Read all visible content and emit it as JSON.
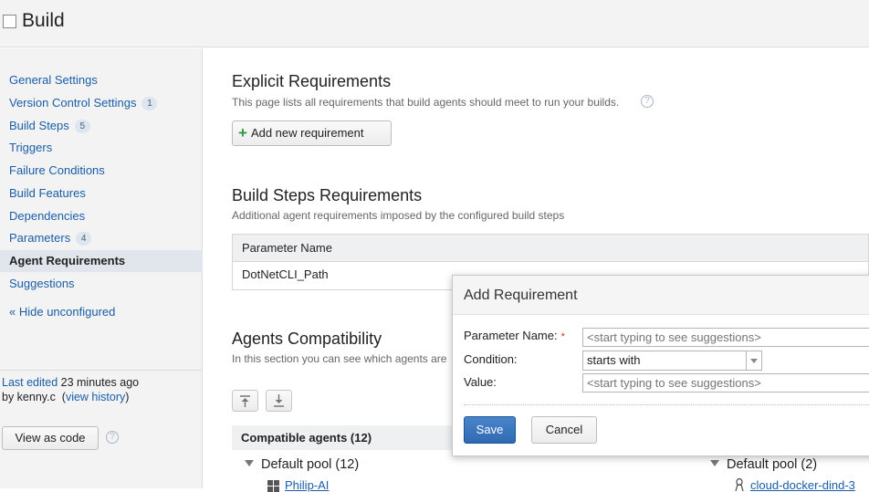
{
  "header": {
    "title": "Build"
  },
  "sidebar": {
    "items": [
      {
        "label": "General Settings",
        "badge": ""
      },
      {
        "label": "Version Control Settings",
        "badge": "1"
      },
      {
        "label": "Build Steps",
        "badge": "5"
      },
      {
        "label": "Triggers",
        "badge": ""
      },
      {
        "label": "Failure Conditions",
        "badge": ""
      },
      {
        "label": "Build Features",
        "badge": ""
      },
      {
        "label": "Dependencies",
        "badge": ""
      },
      {
        "label": "Parameters",
        "badge": "4"
      },
      {
        "label": "Agent Requirements",
        "badge": "",
        "active": true
      },
      {
        "label": "Suggestions",
        "badge": ""
      }
    ],
    "hide_unconfigured": "« Hide unconfigured",
    "last_edited_link": "Last edited",
    "last_edited_time": " 23 minutes ago",
    "by_user": "by kenny.c",
    "open_paren": "(",
    "view_history": "view history",
    "close_paren": ")",
    "view_as_code": "View as code"
  },
  "explicit": {
    "title": "Explicit Requirements",
    "description": "This page lists all requirements that build agents should meet to run your builds.",
    "add_button": "Add new requirement"
  },
  "build_steps_req": {
    "title": "Build Steps Requirements",
    "description": "Additional agent requirements imposed by the configured build steps",
    "column_header": "Parameter Name",
    "rows": [
      "DotNetCLI_Path"
    ]
  },
  "compat": {
    "title": "Agents Compatibility",
    "description": "In this section you can see which agents are",
    "compatible_header": "Compatible agents (12)",
    "pool_left": "Default pool (12)",
    "pool_right": "Default pool (2)",
    "agent_left": "Philip-AI",
    "agent_right": "cloud-docker-dind-3"
  },
  "dialog": {
    "title": "Add Requirement",
    "param_label": "Parameter Name:",
    "required_mark": "*",
    "param_placeholder": "<start typing to see suggestions>",
    "condition_label": "Condition:",
    "condition_value": "starts with",
    "value_label": "Value:",
    "value_placeholder": "<start typing to see suggestions>",
    "save": "Save",
    "cancel": "Cancel"
  },
  "colors": {
    "link": "#1a5da8",
    "primary_button": "#2f69b2",
    "active_nav_bg": "#e1e6ec"
  },
  "icons": [
    "checkbox-icon",
    "help-icon",
    "plus-icon",
    "expand-all-icon",
    "collapse-all-icon",
    "triangle-down-icon",
    "windows-icon",
    "linux-icon"
  ]
}
